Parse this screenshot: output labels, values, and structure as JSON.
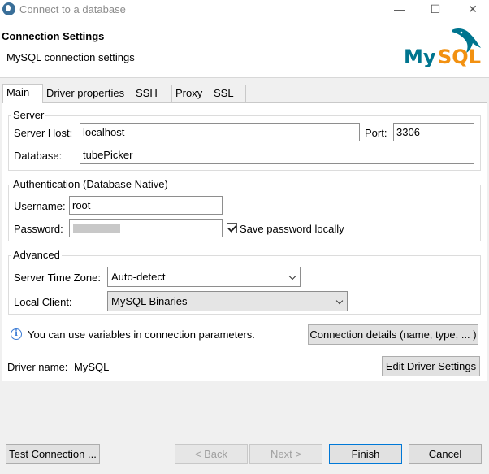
{
  "window": {
    "title": "Connect to a database",
    "minimize_glyph": "—",
    "maximize_glyph": "☐",
    "close_glyph": "✕"
  },
  "header": {
    "title": "Connection Settings",
    "subtitle": "MySQL connection settings",
    "logo_text": "MySQL",
    "logo_colors": {
      "my": "#00758f",
      "sql": "#f29111"
    }
  },
  "tabs": [
    "Main",
    "Driver properties",
    "SSH",
    "Proxy",
    "SSL"
  ],
  "server": {
    "legend": "Server",
    "host_label": "Server Host:",
    "host_value": "localhost",
    "port_label": "Port:",
    "port_value": "3306",
    "database_label": "Database:",
    "database_value": "tubePicker"
  },
  "auth": {
    "legend": "Authentication (Database Native)",
    "username_label": "Username:",
    "username_value": "root",
    "password_label": "Password:",
    "save_password_label": "Save password locally",
    "save_password_checked": true
  },
  "advanced": {
    "legend": "Advanced",
    "timezone_label": "Server Time Zone:",
    "timezone_value": "Auto-detect",
    "local_client_label": "Local Client:",
    "local_client_value": "MySQL Binaries"
  },
  "info": {
    "text": "You can use variables in connection parameters.",
    "details_button": "Connection details (name, type, ... )"
  },
  "driver": {
    "label": "Driver name:",
    "value": "MySQL",
    "edit_button": "Edit Driver Settings"
  },
  "footer": {
    "test_button": "Test Connection ...",
    "back_button": "< Back",
    "next_button": "Next >",
    "finish_button": "Finish",
    "cancel_button": "Cancel"
  }
}
